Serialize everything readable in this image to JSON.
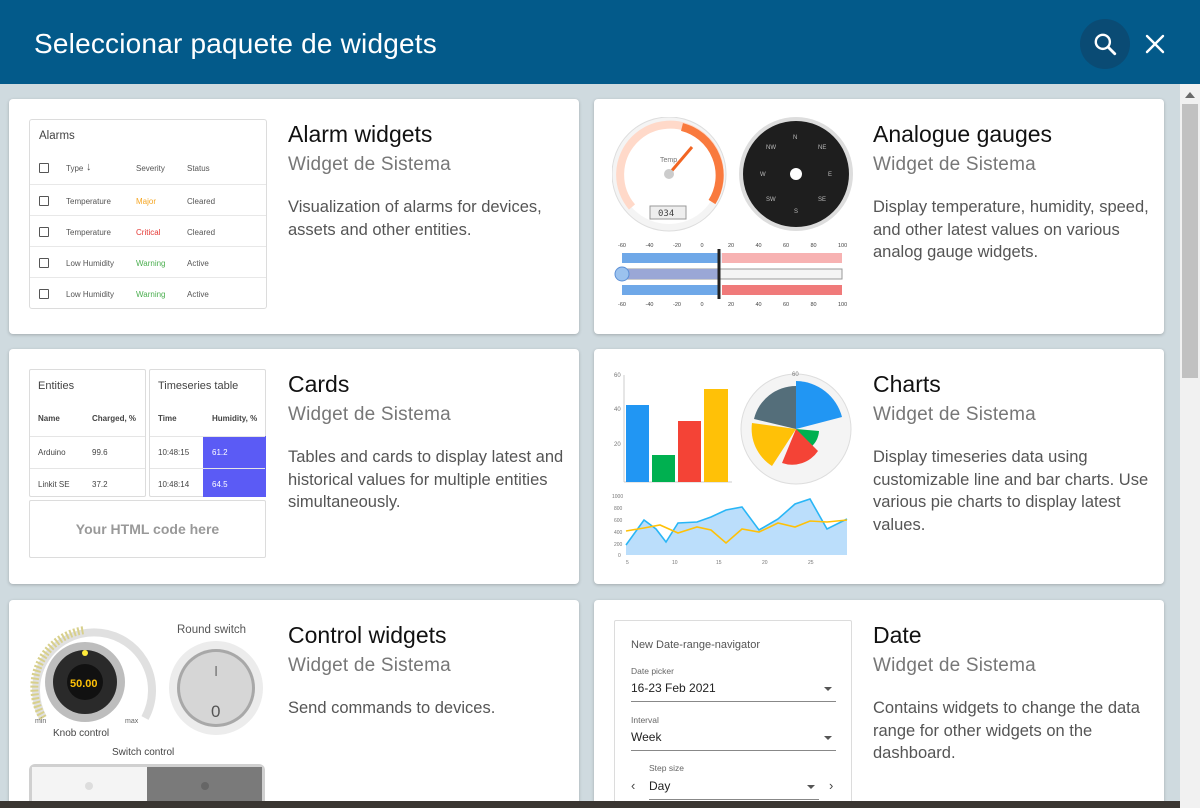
{
  "header": {
    "title": "Seleccionar paquete de widgets",
    "search_icon": "search-icon",
    "close_icon": "close-icon"
  },
  "cards": [
    {
      "title": "Alarm widgets",
      "subtitle": "Widget de Sistema",
      "description": "Visualization of alarms for devices, assets and other entities.",
      "preview": {
        "title": "Alarms",
        "columns": [
          "Type",
          "Severity",
          "Status"
        ],
        "rows": [
          {
            "type": "Temperature",
            "severity": "Major",
            "status": "Cleared",
            "color": "#f5a623"
          },
          {
            "type": "Temperature",
            "severity": "Critical",
            "status": "Cleared",
            "color": "#e53935"
          },
          {
            "type": "Low Humidity",
            "severity": "Warning",
            "status": "Active",
            "color": "#4caf50"
          },
          {
            "type": "Low Humidity",
            "severity": "Warning",
            "status": "Active",
            "color": "#4caf50"
          }
        ]
      }
    },
    {
      "title": "Analogue gauges",
      "subtitle": "Widget de Sistema",
      "description": "Display temperature, humidity, speed, and other latest values on various analog gauge widgets.",
      "preview": {
        "gauge_label": "Temp",
        "gauge_value": "034",
        "compass": [
          "N",
          "NE",
          "E",
          "SE",
          "S",
          "SW",
          "W",
          "NW"
        ],
        "scale": [
          "-60",
          "-40",
          "-20",
          "0",
          "20",
          "40",
          "60",
          "80",
          "100"
        ]
      }
    },
    {
      "title": "Cards",
      "subtitle": "Widget de Sistema",
      "description": "Tables and cards to display latest and historical values for multiple entities simultaneously.",
      "preview": {
        "entities_title": "Entities",
        "entities_cols": [
          "Name",
          "Charged, %"
        ],
        "entities_rows": [
          [
            "Arduino",
            "99.6"
          ],
          [
            "Linkit SE",
            "37.2"
          ]
        ],
        "ts_title": "Timeseries table",
        "ts_cols": [
          "Time",
          "Humidity, %"
        ],
        "ts_rows": [
          [
            "10:48:15",
            "61.2"
          ],
          [
            "10:48:14",
            "64.5"
          ]
        ],
        "html_text": "Your HTML code here"
      }
    },
    {
      "title": "Charts",
      "subtitle": "Widget de Sistema",
      "description": "Display timeseries data using customizable line and bar charts. Use various pie charts to display latest values.",
      "preview": {
        "bar_ticks": [
          "60",
          "40",
          "20"
        ],
        "pie_tick": "60",
        "line_ticks": [
          "1000",
          "800",
          "600",
          "400",
          "200",
          "0"
        ],
        "x_ticks": [
          "5",
          "10",
          "15",
          "20",
          "25"
        ]
      }
    },
    {
      "title": "Control widgets",
      "subtitle": "Widget de Sistema",
      "description": "Send commands to devices.",
      "preview": {
        "knob_value": "50.00",
        "knob_min": "min",
        "knob_max": "max",
        "knob_label": "Knob control",
        "round_switch_label": "Round switch",
        "round_switch_on": "I",
        "round_switch_off": "0",
        "switch_label": "Switch control"
      }
    },
    {
      "title": "Date",
      "subtitle": "Widget de Sistema",
      "description": "Contains widgets to change the data range for other widgets on the dashboard.",
      "preview": {
        "title": "New Date-range-navigator",
        "date_picker_label": "Date picker",
        "date_picker_value": "16-23 Feb 2021",
        "interval_label": "Interval",
        "interval_value": "Week",
        "step_label": "Step size",
        "step_value": "Day"
      }
    }
  ]
}
